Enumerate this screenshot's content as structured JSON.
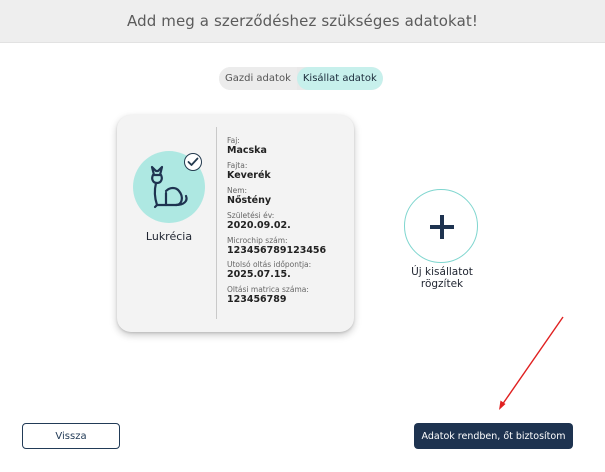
{
  "header": {
    "title": "Add meg a szerződéshez szükséges adatokat!"
  },
  "tabs": [
    {
      "label": "Gazdi adatok",
      "active": false
    },
    {
      "label": "Kisállat adatok",
      "active": true
    }
  ],
  "pet_card": {
    "name": "Lukrécia",
    "selected": true,
    "avatar_icon": "cat-icon",
    "fields": [
      {
        "label": "Faj:",
        "value": "Macska"
      },
      {
        "label": "Fajta:",
        "value": "Keverék"
      },
      {
        "label": "Nem:",
        "value": "Nőstény"
      },
      {
        "label": "Születési év:",
        "value": "2020.09.02."
      },
      {
        "label": "Microchip szám:",
        "value": "123456789123456"
      },
      {
        "label": "Utolsó oltás időpontja:",
        "value": "2025.07.15."
      },
      {
        "label": "Oltási matrica száma:",
        "value": "123456789"
      }
    ]
  },
  "add_pet": {
    "line1": "Új kisállatot",
    "line2": "rögzítek"
  },
  "footer": {
    "back_label": "Vissza",
    "confirm_label": "Adatok rendben, őt biztosítom"
  },
  "colors": {
    "accent_teal": "#aee8e2",
    "primary_navy": "#1e3350",
    "annotation_red": "#e02020"
  }
}
